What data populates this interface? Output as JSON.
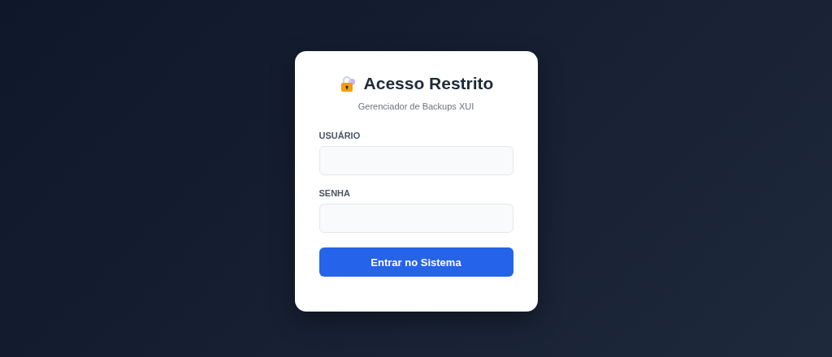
{
  "card": {
    "title": "Acesso Restrito",
    "subtitle": "Gerenciador de Backups XUI"
  },
  "fields": [
    {
      "label": "USUÁRIO"
    },
    {
      "label": "SENHA"
    }
  ],
  "button": {
    "label": "Entrar no Sistema"
  }
}
